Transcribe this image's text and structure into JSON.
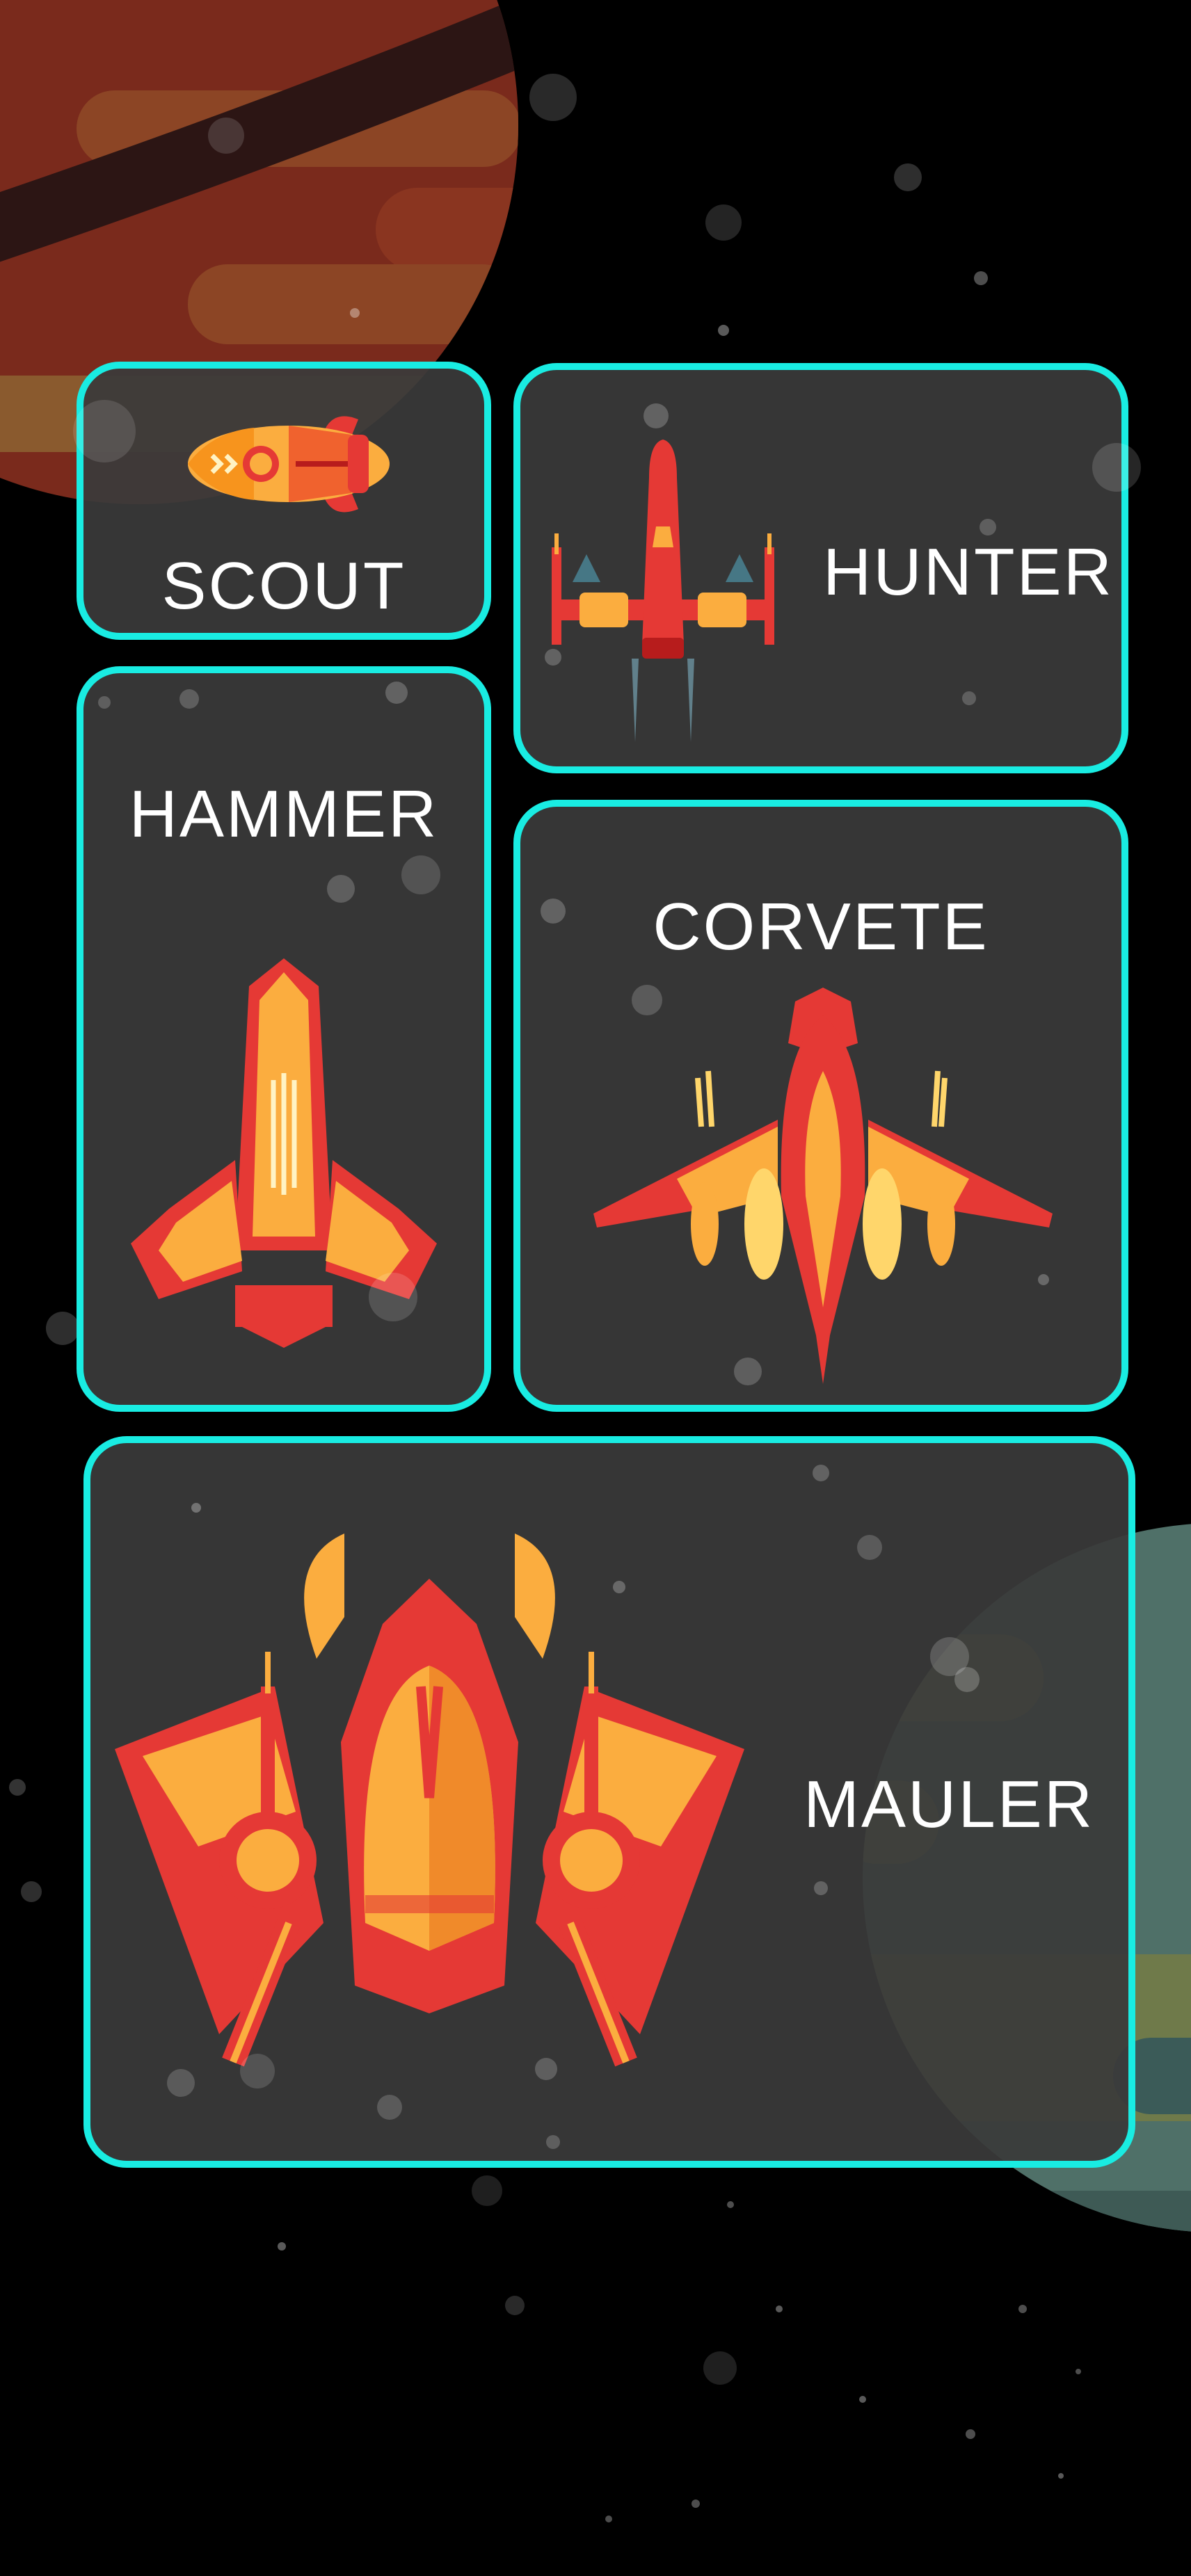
{
  "colors": {
    "background": "#000000",
    "card_fill": "#3a3a3a",
    "card_border": "#19ece2",
    "label": "#ffffff",
    "ship_red": "#e53935",
    "ship_orange": "#fbad3f",
    "planet_top": "#7a2a1c",
    "planet_bottom": "#4f7068"
  },
  "ships": [
    {
      "id": "scout",
      "label": "SCOUT",
      "icon": "rocket-ship-icon"
    },
    {
      "id": "hunter",
      "label": "HUNTER",
      "icon": "x-wing-fighter-icon"
    },
    {
      "id": "hammer",
      "label": "HAMMER",
      "icon": "arrowhead-fighter-icon"
    },
    {
      "id": "corvete",
      "label": "CORVETE",
      "icon": "winged-dragon-ship-icon"
    },
    {
      "id": "mauler",
      "label": "MAULER",
      "icon": "horned-heavy-fighter-icon"
    }
  ]
}
